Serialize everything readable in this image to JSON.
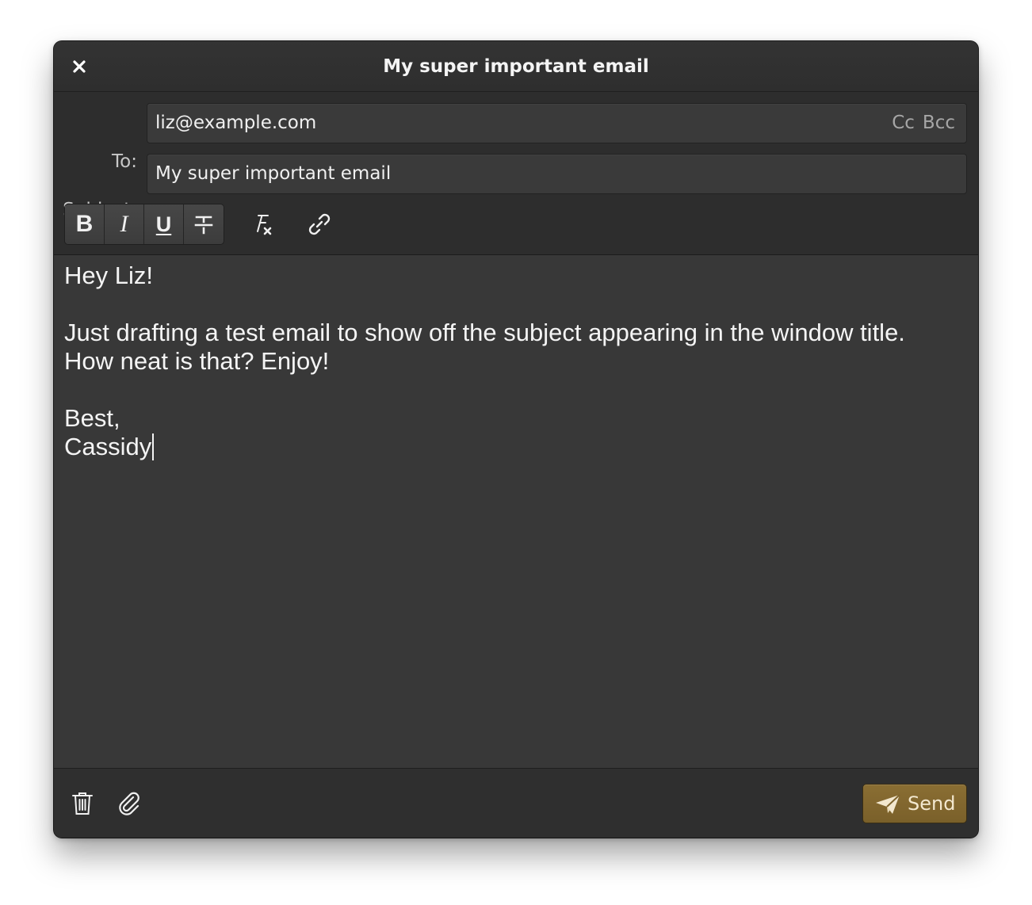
{
  "window": {
    "title": "My super important email"
  },
  "fields": {
    "to_label": "To:",
    "to_value": "liz@example.com",
    "cc_label": "Cc",
    "bcc_label": "Bcc",
    "subject_label": "Subject:",
    "subject_value": "My super important email"
  },
  "toolbar": {
    "bold_label": "B",
    "italic_label": "I",
    "underline_label": "U",
    "strikethrough_icon": "strikethrough-icon",
    "clear_formatting_icon": "clear-formatting-icon",
    "link_icon": "link-icon"
  },
  "body": {
    "text": "Hey Liz!\n\nJust drafting a test email to show off the subject appearing in the window title.\nHow neat is that? Enjoy!\n\nBest,\nCassidy"
  },
  "footer": {
    "delete_icon": "trash-icon",
    "attach_icon": "paperclip-icon",
    "send_label": "Send"
  },
  "colors": {
    "window_bg": "#383838",
    "header_bg": "#2d2d2d",
    "send_accent": "#7e642d",
    "send_text": "#f3e8cf"
  }
}
